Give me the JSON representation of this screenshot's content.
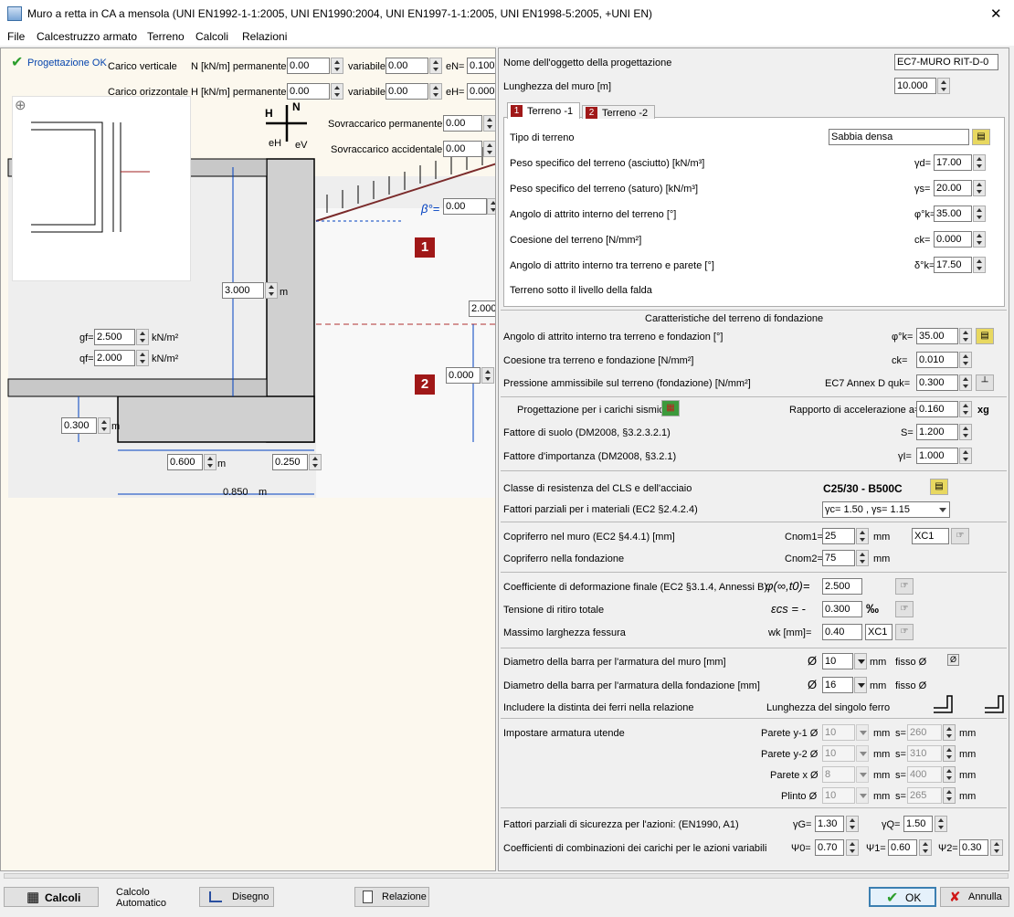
{
  "window": {
    "title": "Muro a retta in CA a mensola (UNI EN1992-1-1:2005, UNI EN1990:2004, UNI EN1997-1-1:2005, UNI EN1998-5:2005, +UNI EN)",
    "close_glyph": "✕"
  },
  "menu": [
    "File",
    "Calcestruzzo armato",
    "Terreno",
    "Calcoli",
    "Relazioni"
  ],
  "left": {
    "status": "Progettazione OK",
    "carico_verticale": {
      "label": "Carico verticale",
      "n_label": "N [kN/m] permanente",
      "n_perm": "0.00",
      "var_label": "variabile",
      "n_var": "0.00",
      "e_label": "eN=",
      "e_val": "0.100"
    },
    "carico_orizzontale": {
      "label": "Carico orizzontale",
      "h_label": "H [kN/m] permanente",
      "h_perm": "0.00",
      "var_label": "variabile",
      "h_var": "0.00",
      "e_label": "eH=",
      "e_val": "0.000"
    },
    "sovraccarico_perm": {
      "label": "Sovraccarico permanente",
      "value": "0.00"
    },
    "sovraccarico_acc": {
      "label": "Sovraccarico accidentale",
      "value": "0.00"
    },
    "beta": {
      "label": "β°=",
      "value": "0.00"
    },
    "h_letter": "H",
    "n_letter": "N",
    "e_h": "eH",
    "e_v": "eV",
    "height": {
      "value": "3.000",
      "unit": "m"
    },
    "gf": {
      "label": "gf=",
      "value": "2.500",
      "unit": "kN/m²"
    },
    "qf": {
      "label": "qf=",
      "value": "2.000",
      "unit": "kN/m²"
    },
    "water_level": "2.000",
    "water_depth": "0.000",
    "base_thickness": {
      "value": "0.300",
      "unit": "m"
    },
    "toe": {
      "value": "0.600",
      "unit": "m"
    },
    "stem": {
      "value": "0.250"
    },
    "base_width": {
      "value": "0.850",
      "unit": "m"
    },
    "terrain1": "1",
    "terrain2": "2"
  },
  "right": {
    "nome": {
      "label": "Nome dell'oggetto della progettazione",
      "value": "EC7-MURO RIT-D-0"
    },
    "lunghezza": {
      "label": "Lunghezza del muro [m]",
      "value": "10.000"
    },
    "tabs": [
      {
        "num": "1",
        "label": "Terreno -1"
      },
      {
        "num": "2",
        "label": "Terreno -2"
      }
    ],
    "terreno": {
      "tipo": {
        "label": "Tipo di terreno",
        "value": "Sabbia densa"
      },
      "peso_asciutto": {
        "label": "Peso specifico del terreno (asciutto) [kN/m³]",
        "sym": "γd=",
        "value": "17.00"
      },
      "peso_saturo": {
        "label": "Peso specifico del terreno (saturo) [kN/m³]",
        "sym": "γs=",
        "value": "20.00"
      },
      "attrito": {
        "label": "Angolo di attrito interno del terreno [°]",
        "sym": "φ°k=",
        "value": "35.00"
      },
      "coesione": {
        "label": "Coesione del terreno [N/mm²]",
        "sym": "ck=",
        "value": "0.000"
      },
      "attrito_parete": {
        "label": "Angolo di attrito interno tra terreno e parete [°]",
        "sym": "δ°k=",
        "value": "17.50"
      },
      "falda": {
        "label": "Terreno sotto il livello della falda"
      }
    },
    "fondazione": {
      "title": "Caratteristiche del terreno di fondazione",
      "attrito": {
        "label": "Angolo di attrito interno tra terreno e fondazion [°]",
        "sym": "φ°k=",
        "value": "35.00"
      },
      "coesione": {
        "label": "Coesione tra terreno e fondazione [N/mm²]",
        "sym": "ck=",
        "value": "0.010"
      },
      "pressione": {
        "label": "Pressione ammissibile sul terreno (fondazione) [N/mm²]",
        "annex": "EC7 Annex D",
        "sym": "quk=",
        "value": "0.300"
      }
    },
    "sismici": {
      "label": "Progettazione per i carichi sismici",
      "rapporto": {
        "label": "Rapporto di accelerazione a=",
        "value": "0.160",
        "unit": "xg"
      },
      "suolo": {
        "label": "Fattore di suolo (DM2008, §3.2.3.2.1)",
        "sym": "S=",
        "value": "1.200"
      },
      "importanza": {
        "label": "Fattore d'importanza (DM2008, §3.2.1)",
        "sym": "γI=",
        "value": "1.000"
      }
    },
    "materiali": {
      "classe": {
        "label": "Classe di resistenza del CLS e dell'acciaio",
        "value": "C25/30 - B500C"
      },
      "fattori": {
        "label": "Fattori parziali per i materiali (EC2 §2.4.2.4)",
        "value": "γc= 1.50 , γs= 1.15"
      }
    },
    "copriferro": {
      "muro": {
        "label": "Copriferro nel muro (EC2 §4.4.1) [mm]",
        "sym": "Cnom1=",
        "value": "25",
        "unit": "mm",
        "exposure": "XC1"
      },
      "fondazione": {
        "label": "Copriferro nella fondazione",
        "sym": "Cnom2=",
        "value": "75",
        "unit": "mm"
      }
    },
    "deformazione": {
      "coeff": {
        "label": "Coefficiente di deformazione finale (EC2 §3.1.4, Annessi B)",
        "sym": "φ(∞,t0)=",
        "value": "2.500"
      },
      "ritiro": {
        "label": "Tensione di ritiro totale",
        "sym": "εcs = -",
        "value": "0.300",
        "unit": "‰"
      },
      "fessura": {
        "label": "Massimo larghezza fessura",
        "sym": "wk [mm]=",
        "value": "0.40",
        "exposure": "XC1"
      }
    },
    "armatura": {
      "muro": {
        "label": "Diametro della barra per l'armatura del muro [mm]",
        "sym": "Ø",
        "value": "10",
        "unit": "mm",
        "fisso": "fisso Ø"
      },
      "fondazione": {
        "label": "Diametro della barra per l'armatura della fondazione [mm]",
        "sym": "Ø",
        "value": "16",
        "unit": "mm",
        "fisso": "fisso Ø"
      },
      "distinta": {
        "label": "Includere la distinta dei ferri nella relazione",
        "lunghezza": "Lunghezza del singolo ferro"
      }
    },
    "utente": {
      "label": "Impostare armatura utende",
      "rows": [
        {
          "label": "Parete y-1 Ø",
          "dia": "10",
          "unit": "mm",
          "s_label": "s=",
          "s": "260",
          "s_unit": "mm"
        },
        {
          "label": "Parete y-2 Ø",
          "dia": "10",
          "unit": "mm",
          "s_label": "s=",
          "s": "310",
          "s_unit": "mm"
        },
        {
          "label": "Parete x Ø",
          "dia": "8",
          "unit": "mm",
          "s_label": "s=",
          "s": "400",
          "s_unit": "mm"
        },
        {
          "label": "Plinto Ø",
          "dia": "10",
          "unit": "mm",
          "s_label": "s=",
          "s": "265",
          "s_unit": "mm"
        }
      ]
    },
    "sicurezza": {
      "label": "Fattori parziali di sicurezza per l'azioni: (EN1990, A1)",
      "gG": {
        "sym": "γG=",
        "value": "1.30"
      },
      "gQ": {
        "sym": "γQ=",
        "value": "1.50"
      }
    },
    "combinazioni": {
      "label": "Coefficienti di combinazioni dei carichi per le azioni variabili",
      "psi0": {
        "sym": "Ψ0=",
        "value": "0.70"
      },
      "psi1": {
        "sym": "Ψ1=",
        "value": "0.60"
      },
      "psi2": {
        "sym": "Ψ2=",
        "value": "0.30"
      }
    }
  },
  "bottom": {
    "calcoli": "Calcoli",
    "calcolo_auto": "Calcolo Automatico",
    "disegno": "Disegno",
    "relazione": "Relazione",
    "ok": "OK",
    "annulla": "Annulla"
  },
  "icons": {
    "check": "✔",
    "cross": "✘",
    "zoom": "⊕",
    "calc": "▦"
  }
}
